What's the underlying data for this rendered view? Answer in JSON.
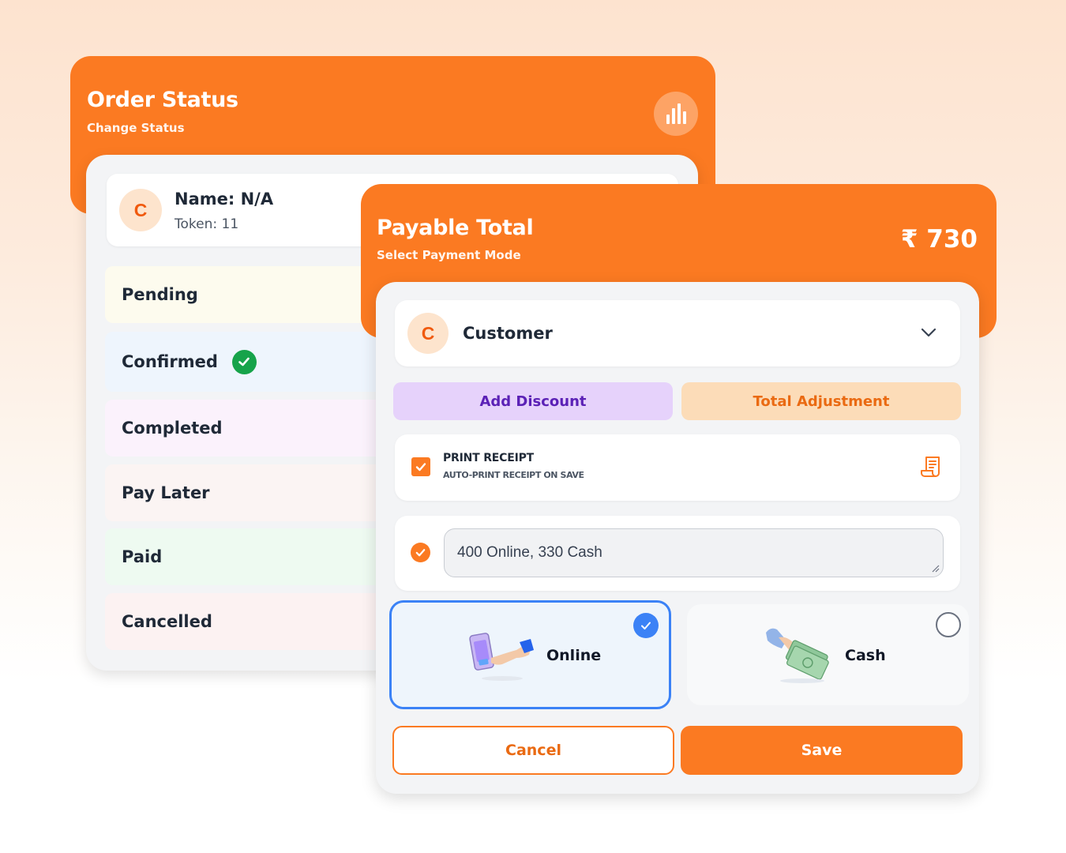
{
  "order_status": {
    "title": "Order Status",
    "subtitle": "Change Status",
    "stats_icon": "bar-chart-icon",
    "customer": {
      "avatar_letter": "C",
      "name": "Name: N/A",
      "token": "Token: 11"
    },
    "statuses": [
      {
        "label": "Pending",
        "bg": "#fdfbee",
        "checked": false
      },
      {
        "label": "Confirmed",
        "bg": "#eef5fd",
        "checked": true
      },
      {
        "label": "Completed",
        "bg": "#fbf2fc",
        "checked": false
      },
      {
        "label": "Pay Later",
        "bg": "#fbf4f3",
        "checked": false
      },
      {
        "label": "Paid",
        "bg": "#eefaf1",
        "checked": false
      },
      {
        "label": "Cancelled",
        "bg": "#fcf2f2",
        "checked": false
      }
    ]
  },
  "payment": {
    "title": "Payable Total",
    "subtitle": "Select Payment Mode",
    "amount": "₹ 730",
    "customer": {
      "avatar_letter": "C",
      "label": "Customer"
    },
    "add_discount_label": "Add Discount",
    "total_adjustment_label": "Total Adjustment",
    "print_receipt": {
      "checked": true,
      "title": "PRINT RECEIPT",
      "subtitle": "AUTO-PRINT RECEIPT ON SAVE"
    },
    "note": {
      "checked": true,
      "value": "400 Online, 330 Cash"
    },
    "modes": [
      {
        "label": "Online",
        "selected": true
      },
      {
        "label": "Cash",
        "selected": false
      }
    ],
    "cancel_label": "Cancel",
    "save_label": "Save"
  },
  "colors": {
    "brand_orange": "#fb7a22",
    "success_green": "#16a34a",
    "selected_blue": "#3b82f6"
  }
}
